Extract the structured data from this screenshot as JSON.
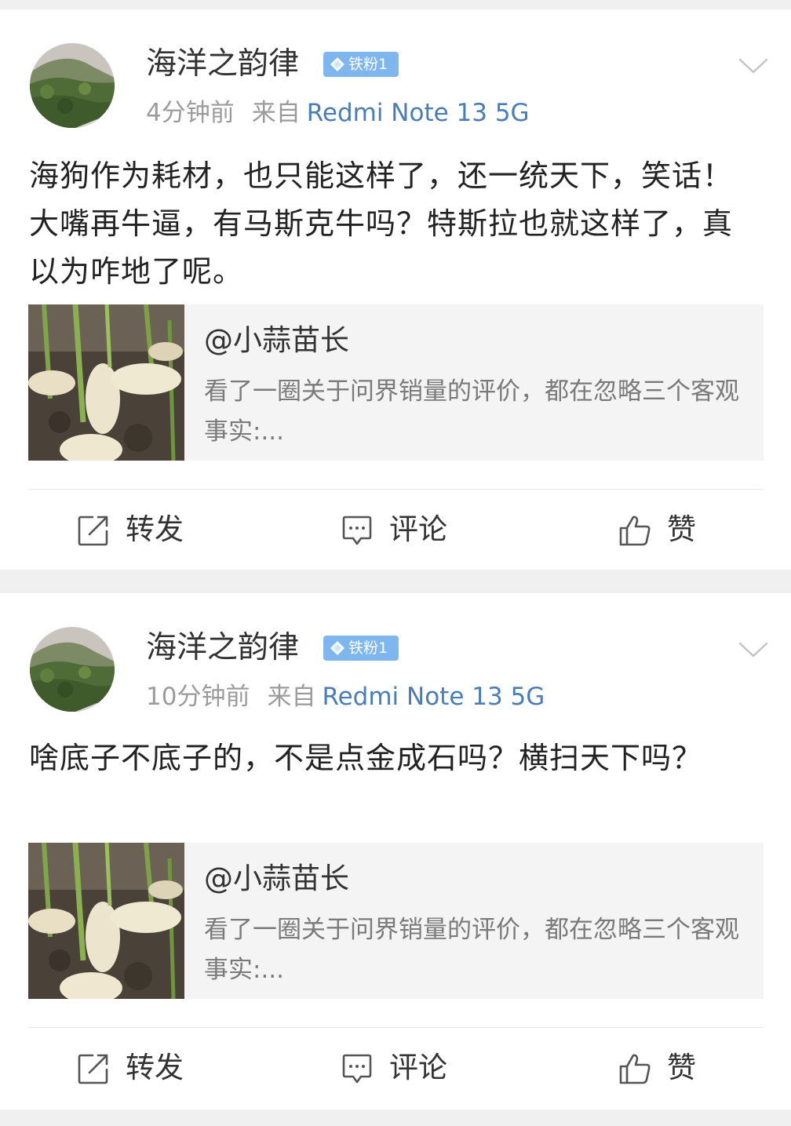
{
  "posts": [
    {
      "username": "海洋之韵律",
      "badge": "铁粉1",
      "time": "4分钟前",
      "from_label": "来自",
      "device": "Redmi Note 13 5G",
      "text": "海狗作为耗材，也只能这样了，还一统天下，笑话！大嘴再牛逼，有马斯克牛吗？特斯拉也就这样了，真以为咋地了呢。",
      "repost": {
        "user": "@小蒜苗长",
        "text": "看了一圈关于问界销量的评价，都在忽略三个客观事实:..."
      },
      "actions": {
        "forward": "转发",
        "comment": "评论",
        "like": "赞"
      }
    },
    {
      "username": "海洋之韵律",
      "badge": "铁粉1",
      "time": "10分钟前",
      "from_label": "来自",
      "device": "Redmi Note 13 5G",
      "text": "啥底子不底子的，不是点金成石吗？横扫天下吗？",
      "repost": {
        "user": "@小蒜苗长",
        "text": "看了一圈关于问界销量的评价，都在忽略三个客观事实:..."
      },
      "actions": {
        "forward": "转发",
        "comment": "评论",
        "like": "赞"
      }
    }
  ],
  "icons": {
    "badge": "diamond-icon",
    "menu": "chevron-down-icon",
    "forward": "share-square-icon",
    "comment": "comment-bubble-icon",
    "like": "thumbs-up-icon"
  },
  "colors": {
    "background": "#f0f0f0",
    "card": "#ffffff",
    "badge": "#7fb6ee",
    "device_link": "#4a7db5",
    "meta": "#9b9b9b",
    "text": "#222222"
  }
}
